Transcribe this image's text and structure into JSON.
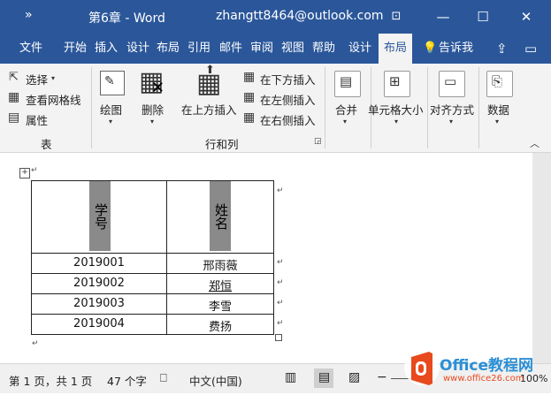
{
  "titlebar": {
    "overflow": "»",
    "doc_title": "第6章 - Word",
    "account": "zhangtt8464@outlook.com",
    "restore_ribbon_icon": "⊡",
    "min_icon": "—",
    "max_icon": "☐",
    "close_icon": "✕"
  },
  "tabs": [
    "文件",
    "开始",
    "插入",
    "设计",
    "布局",
    "引用",
    "邮件",
    "审阅",
    "视图",
    "帮助",
    "设计",
    "布局"
  ],
  "tell_me": "告诉我",
  "ribbon": {
    "select": "选择",
    "view_gridlines": "查看网格线",
    "properties": "属性",
    "group_table": "表",
    "draw": "绘图",
    "delete": "删除",
    "insert_above": "在上方插入",
    "insert_below": "在下方插入",
    "insert_left": "在左侧插入",
    "insert_right": "在右侧插入",
    "group_rows_cols": "行和列",
    "merge": "合并",
    "cell_size": "单元格大小",
    "alignment": "对齐方式",
    "data": "数据"
  },
  "table": {
    "headers": [
      "学号",
      "姓名"
    ],
    "rows": [
      [
        "2019001",
        "邢雨薇"
      ],
      [
        "2019002",
        "郑恒"
      ],
      [
        "2019003",
        "李雪"
      ],
      [
        "2019004",
        "费扬"
      ]
    ]
  },
  "marks": {
    "para": "↵",
    "cell_end": "↵",
    "head_mark": "↵"
  },
  "status": {
    "page": "第 1 页，共 1 页",
    "words": "47 个字",
    "language": "中文(中国)",
    "zoom": "100%"
  },
  "watermark": {
    "brand": "Office教程网",
    "url": "www.office26.com"
  },
  "colors": {
    "word_blue": "#2b579a",
    "office_orange": "#e8491d"
  }
}
